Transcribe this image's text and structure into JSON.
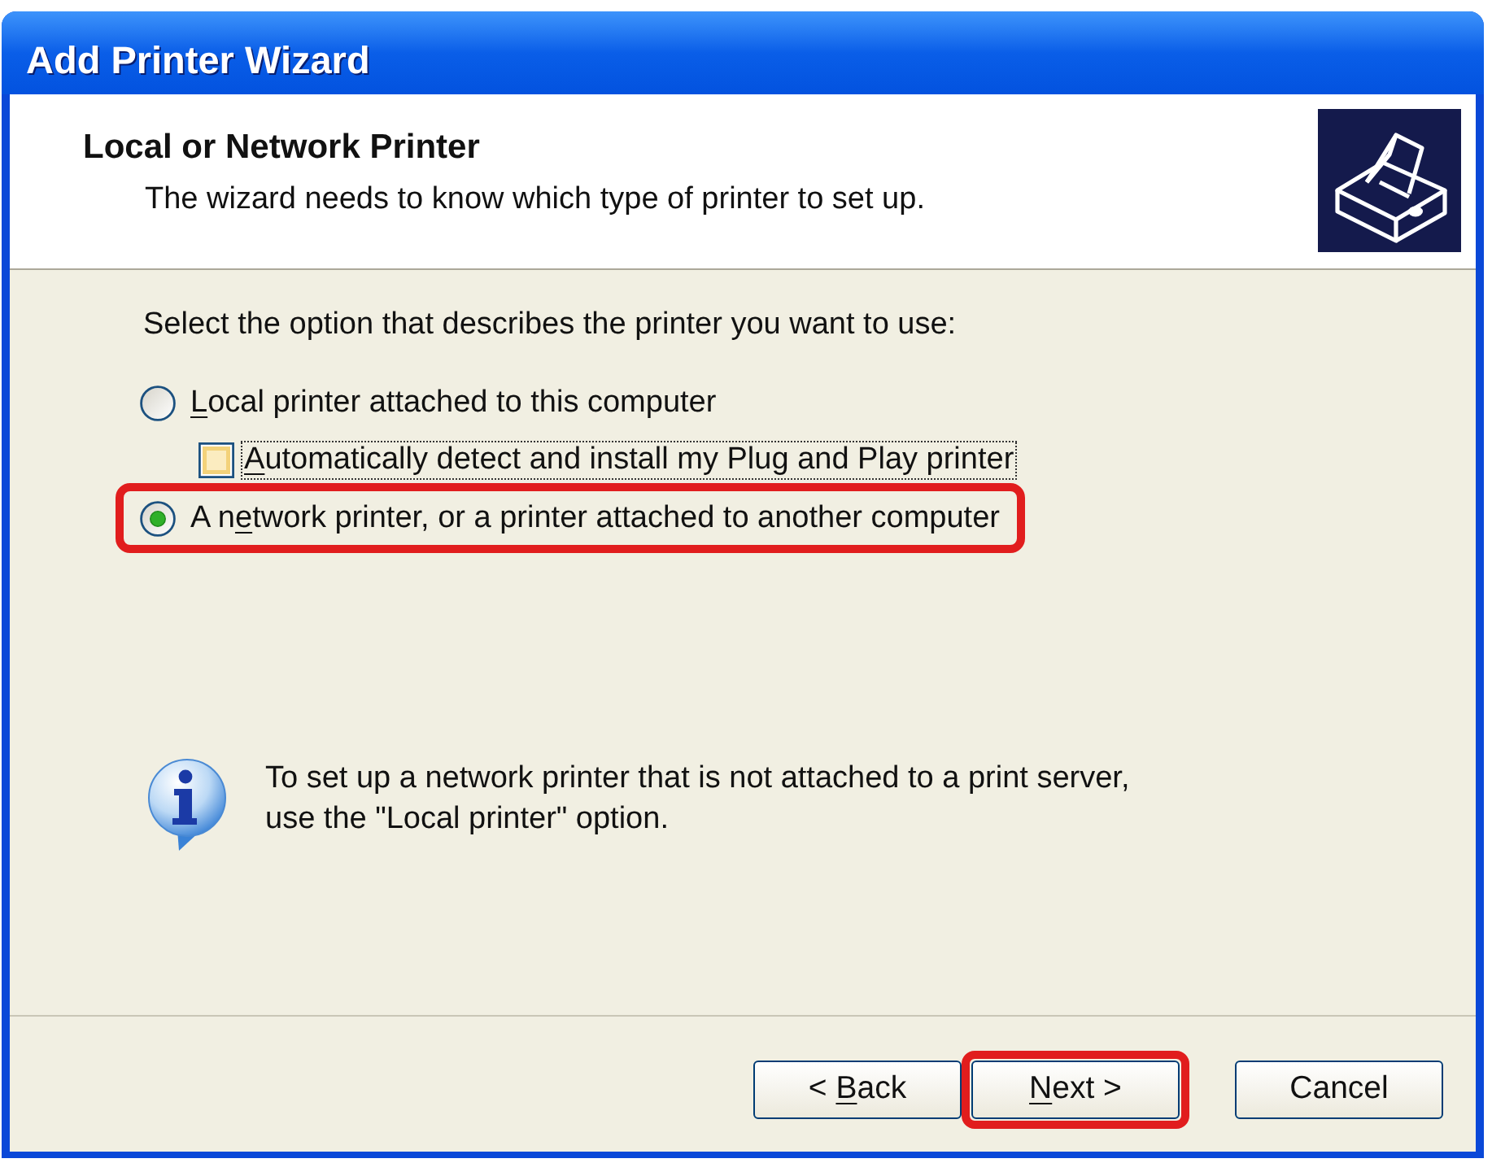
{
  "window": {
    "title": "Add Printer Wizard"
  },
  "header": {
    "title": "Local or Network Printer",
    "subtitle": "The wizard needs to know which type of printer to set up."
  },
  "prompt": "Select the option that describes the printer you want to use:",
  "options": [
    {
      "kind": "radio",
      "label": {
        "access_key": "L",
        "text_after": "ocal printer attached to this computer"
      },
      "selected": false,
      "highlighted": false,
      "children": [
        {
          "kind": "checkbox",
          "label": {
            "access_key": "A",
            "text_after": "utomatically detect and install my Plug and Play printer"
          },
          "checked": false,
          "focused": true
        }
      ]
    },
    {
      "kind": "radio",
      "label": {
        "text_before": "A n",
        "access_key": "e",
        "text_after": "twork printer, or a printer attached to another computer"
      },
      "selected": true,
      "highlighted": true
    }
  ],
  "note": "To set up a network printer that is not attached to a print server,\nuse the \"Local printer\" option.",
  "buttons": [
    {
      "label": {
        "text_before": "< ",
        "access_key": "B",
        "text_after": "ack"
      },
      "highlighted": false
    },
    {
      "label": {
        "access_key": "N",
        "text_after": "ext >"
      },
      "highlighted": true
    },
    {
      "label": {
        "text_before": "Cancel"
      },
      "highlighted": false
    }
  ]
}
